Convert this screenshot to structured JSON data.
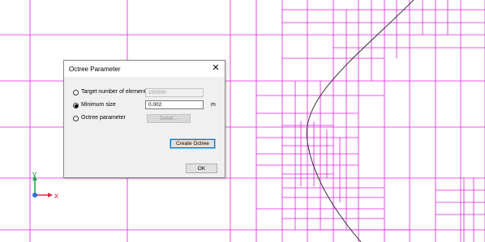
{
  "dialog": {
    "title": "Octree Parameter",
    "close_glyph": "✕",
    "options": [
      {
        "label": "Target number of elements",
        "selected": false
      },
      {
        "label": "Minimum size",
        "selected": true
      },
      {
        "label": "Octree parameter",
        "selected": false
      }
    ],
    "target_number": {
      "value": "100000",
      "enabled": false
    },
    "minimum_size": {
      "value": "0.002",
      "unit": "m",
      "enabled": true
    },
    "detail_button": {
      "label": "Detail...",
      "enabled": false
    },
    "create_button": {
      "label": "Create Octree"
    },
    "ok_button": {
      "label": "OK"
    }
  },
  "axes": {
    "x_label": "x",
    "y_label": "y",
    "x_color": "#e0284a",
    "y_color": "#22a84a",
    "origin_color": "#2a6fdb"
  },
  "colors": {
    "mesh": "#e020e0",
    "curve": "#222222"
  }
}
